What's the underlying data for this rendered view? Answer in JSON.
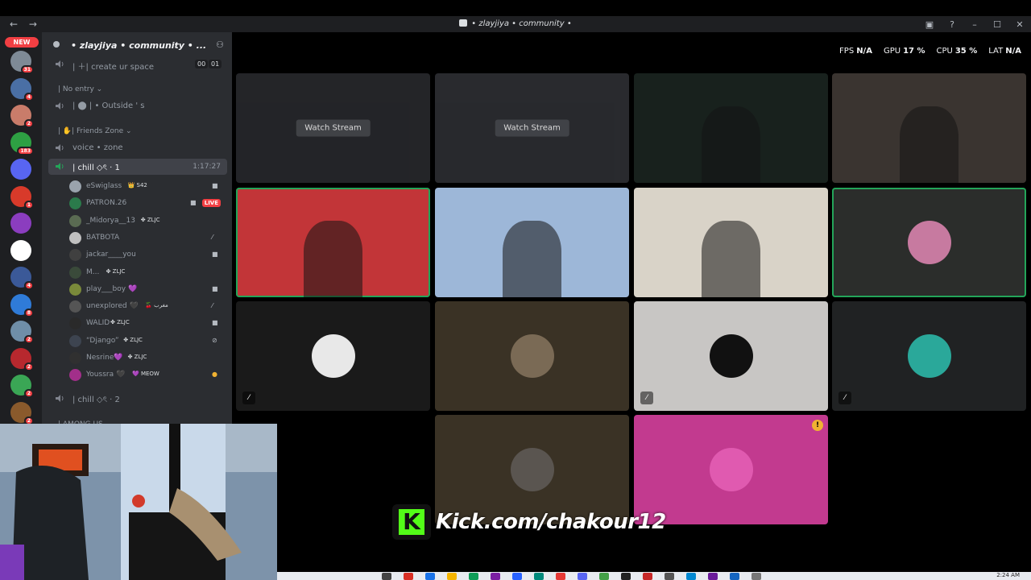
{
  "window": {
    "title": "• zlayjiya • community •",
    "back": "←",
    "forward": "→",
    "minimize": "–",
    "maximize": "☐",
    "close": "✕"
  },
  "rail": {
    "new_badge": "NEW",
    "servers": [
      {
        "badge": "31",
        "color": "#7e8a96"
      },
      {
        "badge": "4",
        "color": "#4a6fa5"
      },
      {
        "badge": "2",
        "color": "#c97c6a"
      },
      {
        "badge": "183",
        "color": "#2ea043"
      },
      {
        "badge": "",
        "color": "#5865f2"
      },
      {
        "badge": "1",
        "color": "#d83a2a"
      },
      {
        "badge": "",
        "color": "#8b3dbf"
      },
      {
        "badge": "",
        "color": "#ffffff"
      },
      {
        "badge": "4",
        "color": "#3b5998"
      },
      {
        "badge": "8",
        "color": "#2f7bd8"
      },
      {
        "badge": "2",
        "color": "#6f8ea8"
      },
      {
        "badge": "2",
        "color": "#b7282e"
      },
      {
        "badge": "2",
        "color": "#3aa655"
      },
      {
        "badge": "2",
        "color": "#8a5a2c"
      }
    ]
  },
  "sidebar": {
    "server_name": "• zlayjiya • community • ...",
    "channels": {
      "create": {
        "label": "| ＋| create ur space",
        "count_a": "00",
        "count_b": "01"
      },
      "no_entry": "| No entry ⌄",
      "outside": "| ⬤ | • Outside ' s",
      "friends_zone": "| ✋| Friends Zone ⌄",
      "voice_zone": "voice • zone",
      "chill1": {
        "label": "| chill ◇ৎ · 1",
        "timer": "1:17:27"
      },
      "chill2": "| chill ◇ৎ · 2",
      "among": "| AMONG US"
    },
    "members": [
      {
        "name": "eSwiglass",
        "tag": "👑 S42",
        "status": "camera",
        "avatar": "#9aa3ad"
      },
      {
        "name": "PATRON.26",
        "tag": "",
        "status": "live",
        "avatar": "#2b7a4b"
      },
      {
        "name": "_Midorya__13",
        "tag": "✤ ZLJC",
        "status": "",
        "avatar": "#5a6b52"
      },
      {
        "name": "BATBOTA",
        "tag": "",
        "status": "muted",
        "avatar": "#c0c0c0"
      },
      {
        "name": "jackar____you",
        "tag": "",
        "status": "camera",
        "avatar": "#404040"
      },
      {
        "name": "M...",
        "tag": "✤ ZLJC",
        "status": "",
        "avatar": "#3a4a3a"
      },
      {
        "name": "play___boy 💜",
        "tag": "",
        "status": "camera",
        "avatar": "#7a8a3a"
      },
      {
        "name": "unexplored 🖤",
        "tag": "🍒 مغرب",
        "status": "muted",
        "avatar": "#555"
      },
      {
        "name": "WALID",
        "tag": "✤ ZLJC",
        "status": "camera",
        "avatar": "#2a2a2a"
      },
      {
        "name": "“Django”",
        "tag": "✤ ZLJC",
        "status": "deafen",
        "avatar": "#3d4450"
      },
      {
        "name": "Nesrine💜",
        "tag": "✤ ZLJC",
        "status": "",
        "avatar": "#303030"
      },
      {
        "name": "Youssra 🖤",
        "tag": "💜 MEOW",
        "status": "warn",
        "avatar": "#a22f8a"
      }
    ],
    "live_label": "LIVE"
  },
  "stats": {
    "fps_label": "FPS",
    "fps": "N/A",
    "gpu_label": "GPU",
    "gpu": "17 %",
    "cpu_label": "CPU",
    "cpu": "35 %",
    "lat_label": "LAT",
    "lat": "N/A"
  },
  "stage": {
    "watch_label": "Watch Stream",
    "warn": "!",
    "tiles": [
      {
        "type": "stream",
        "bg": "#2a2b2f"
      },
      {
        "type": "stream",
        "bg": "#303136"
      },
      {
        "type": "video",
        "bg": "#18211d"
      },
      {
        "type": "video",
        "bg": "#3a3430"
      },
      {
        "type": "video",
        "bg": "#c23538"
      },
      {
        "type": "video",
        "bg": "#9db7d8"
      },
      {
        "type": "video",
        "bg": "#d9d3c8"
      },
      {
        "type": "avatar",
        "bg": "#2b2d2b",
        "avatar": "#c77aa0"
      },
      {
        "type": "avatar",
        "bg": "#1a1a1a",
        "avatar": "#e8e8e8"
      },
      {
        "type": "avatar",
        "bg": "#3a3225",
        "avatar": "#7a6a55"
      },
      {
        "type": "avatar",
        "bg": "#c8c6c4",
        "avatar": "#111"
      },
      {
        "type": "avatar",
        "bg": "#202223",
        "avatar": "#2aa89a"
      },
      {
        "type": "avatar",
        "bg": "#3a3225",
        "avatar": "#5a5550"
      },
      {
        "type": "avatar",
        "bg": "#c23a8f",
        "avatar": "#e05ab0"
      }
    ]
  },
  "overlay": {
    "kick_logo": "K",
    "kick_url": "Kick.com/chakour12"
  },
  "taskbar": {
    "clock": "2:24 AM"
  }
}
